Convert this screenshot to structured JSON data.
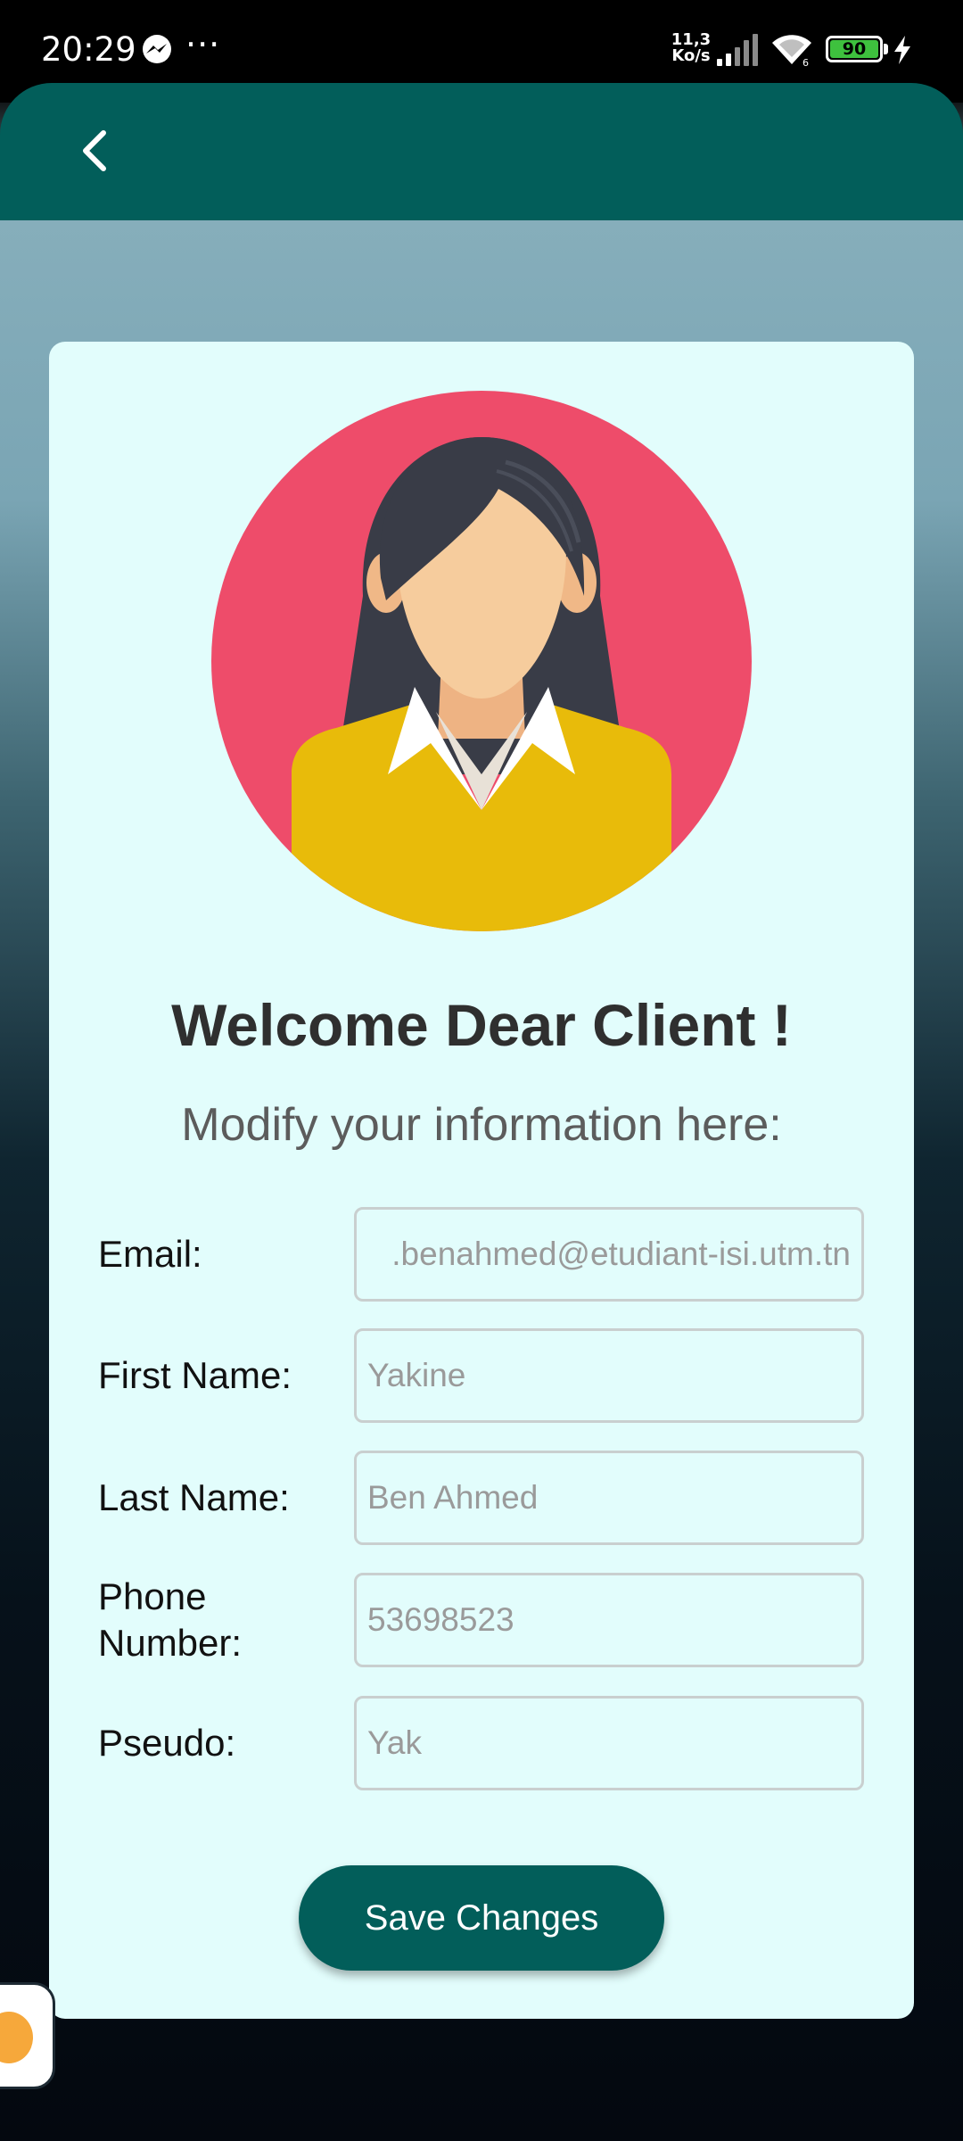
{
  "status_bar": {
    "time": "20:29",
    "more": "···",
    "net_speed_value": "11,3",
    "net_speed_unit": "Ko/s",
    "battery_level": "90",
    "icons": [
      "messenger-icon",
      "signal-icon",
      "wifi-icon",
      "battery-icon",
      "charging-icon"
    ]
  },
  "app_bar": {
    "back_icon": "chevron-left-icon",
    "background_color": "#025e5a"
  },
  "profile": {
    "avatar_icon": "woman-avatar-icon",
    "title": "Welcome Dear Client !",
    "subtitle": "Modify your information here:"
  },
  "form": {
    "fields": [
      {
        "label": "Email:",
        "value": ".benahmed@etudiant-isi.utm.tn"
      },
      {
        "label": "First Name:",
        "value": "Yakine"
      },
      {
        "label": "Last Name:",
        "value": "Ben Ahmed"
      },
      {
        "label": "Phone Number:",
        "value": "53698523"
      },
      {
        "label": "Pseudo:",
        "value": "Yak"
      }
    ],
    "save_label": "Save Changes"
  },
  "colors": {
    "primary": "#025e5a",
    "card_background": "#e2fdfc",
    "avatar_background": "#ee4c6a",
    "shirt": "#e8bb0a"
  }
}
